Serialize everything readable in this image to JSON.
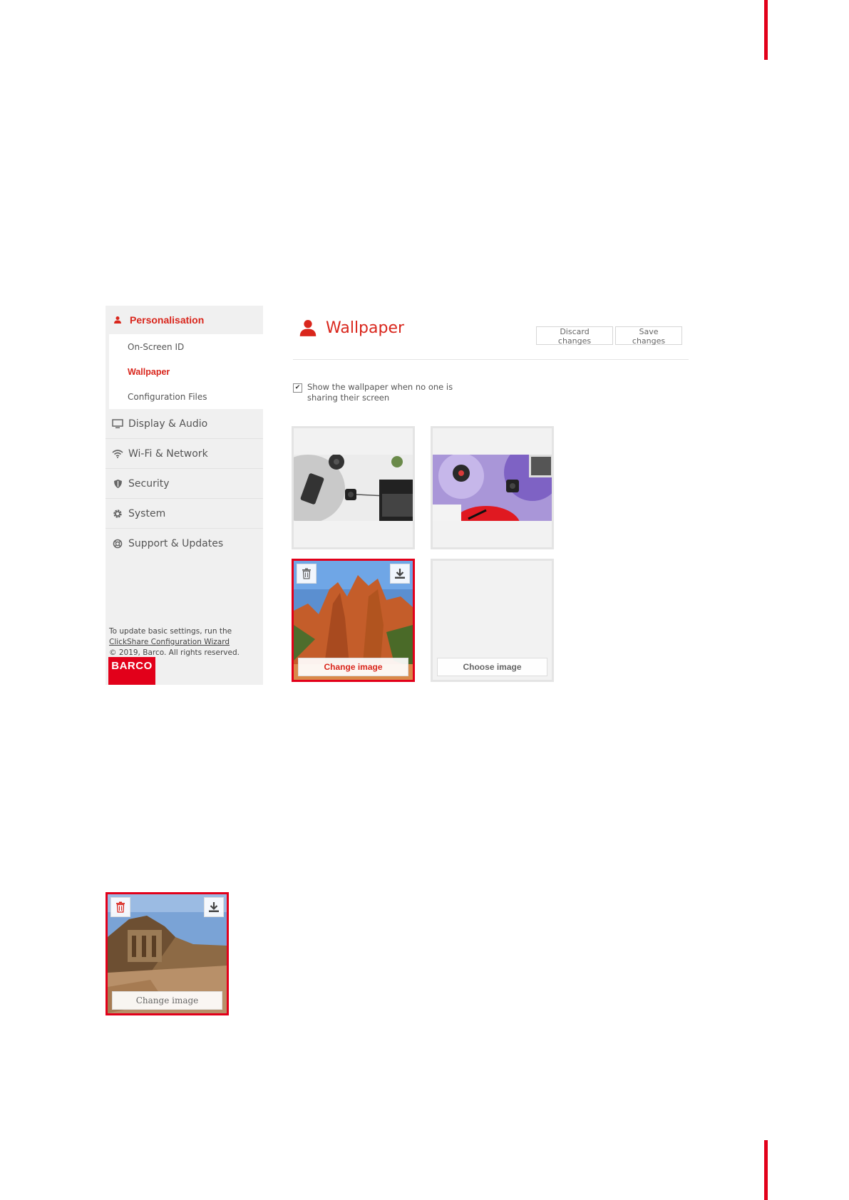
{
  "sidebar": {
    "section_title": "Personalisation",
    "sub_items": [
      {
        "label": "On-Screen ID",
        "active": false
      },
      {
        "label": "Wallpaper",
        "active": true
      },
      {
        "label": "Configuration Files",
        "active": false
      }
    ],
    "items": [
      {
        "label": "Display & Audio",
        "icon": "monitor-icon"
      },
      {
        "label": "Wi-Fi & Network",
        "icon": "wifi-icon"
      },
      {
        "label": "Security",
        "icon": "shield-icon"
      },
      {
        "label": "System",
        "icon": "gear-icon"
      },
      {
        "label": "Support & Updates",
        "icon": "lifebuoy-icon"
      }
    ],
    "footer": {
      "line1": "To update basic settings, run the",
      "link": "ClickShare Configuration Wizard",
      "copyright": "© 2019, Barco. All rights reserved."
    },
    "logo": "BARCO"
  },
  "main": {
    "title": "Wallpaper",
    "title_icon": "user-icon",
    "discard_label": "Discard changes",
    "save_label": "Save changes",
    "show_wallpaper_label": "Show the wallpaper when no one is sharing their screen",
    "show_wallpaper_checked": true,
    "tiles": [
      {
        "name": "wallpaper-desk-gray",
        "button": ""
      },
      {
        "name": "wallpaper-desk-purple",
        "button": ""
      },
      {
        "name": "wallpaper-canyon",
        "button": "Change image",
        "selected": true
      },
      {
        "name": "wallpaper-empty",
        "button": "Choose image"
      }
    ]
  },
  "zoom_tile": {
    "button": "Change image"
  },
  "colors": {
    "accent": "#e2001a",
    "sidebar_bg": "#f0f0f0",
    "text_red": "#d9261c"
  }
}
